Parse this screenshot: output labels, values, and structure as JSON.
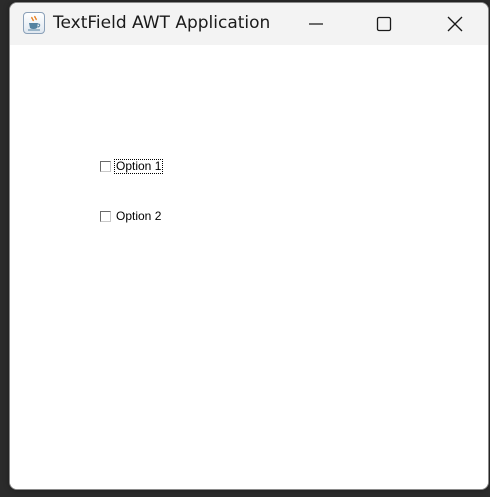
{
  "window": {
    "title": "TextField AWT Application",
    "app_icon": "java-cup-icon",
    "controls": [
      "minimize-icon",
      "maximize-icon",
      "close-icon"
    ]
  },
  "checkboxes": [
    {
      "label": "Option 1",
      "checked": false,
      "focused": true
    },
    {
      "label": "Option 2",
      "checked": false,
      "focused": false
    }
  ]
}
